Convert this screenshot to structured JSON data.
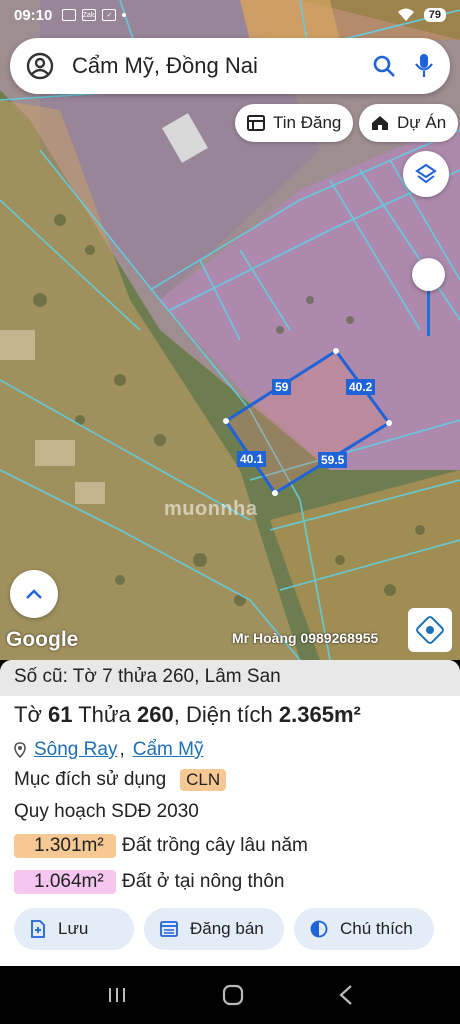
{
  "status_bar": {
    "time": "09:10",
    "battery": "79",
    "notif_label": "Zalo"
  },
  "search": {
    "query": "Cẩm Mỹ, Đồng Nai"
  },
  "chips": {
    "listings": "Tin Đăng",
    "projects": "Dự Án"
  },
  "plot": {
    "edges": [
      "59",
      "40.2",
      "40.1",
      "59.5"
    ]
  },
  "map": {
    "google_label": "Google",
    "contact": "Mr Hoàng 0989268955",
    "watermark": "muonnha"
  },
  "info": {
    "old_label": "Số cũ: Tờ 7 thửa 260, Lâm San",
    "sheet_label": "Tờ",
    "sheet": "61",
    "parcel_label": "Thửa",
    "parcel": "260",
    "area_label": "Diện tích",
    "area": "2.365m²",
    "commune": "Sông Ray",
    "district": "Cẩm Mỹ",
    "purpose_label": "Mục đích sử dụng",
    "purpose_code": "CLN",
    "plan_label": "Quy hoạch SDĐ 2030",
    "zones": [
      {
        "area": "1.301m²",
        "desc": "Đất trồng cây lâu năm",
        "color": "#f6c894"
      },
      {
        "area": "1.064m²",
        "desc": "Đất ở tại nông thôn",
        "color": "#f5c6f0"
      }
    ]
  },
  "actions": {
    "save": "Lưu",
    "post": "Đăng bán",
    "legend": "Chú thích"
  },
  "colors": {
    "accent": "#1f63d8",
    "link": "#1f6fb8"
  }
}
